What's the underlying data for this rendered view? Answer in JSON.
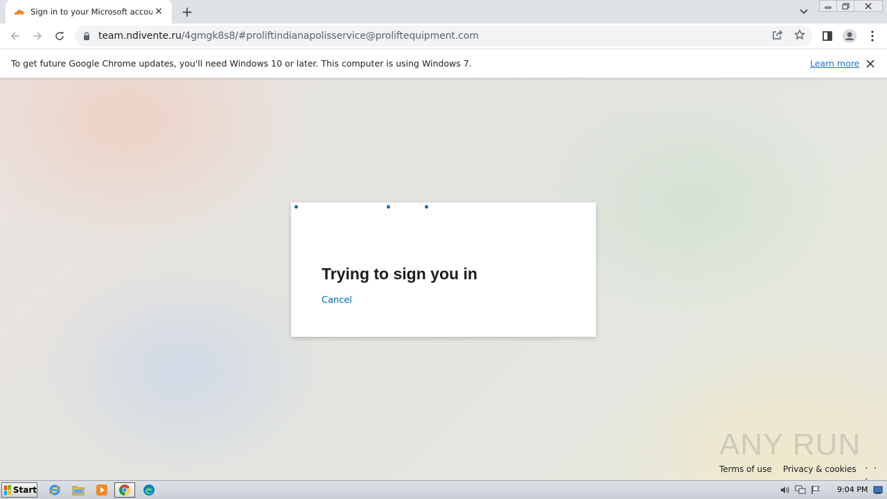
{
  "browser": {
    "tab": {
      "title": "Sign in to your Microsoft account",
      "favicon": "cloudflare-icon",
      "close_glyph": "✕"
    },
    "new_tab_glyph": "+",
    "address": {
      "host": "team.ndivente.ru",
      "path": "/4gmgk8s8/#proliftindianapolisservice@proliftequipment.com"
    }
  },
  "infobar": {
    "message": "To get future Google Chrome updates, you'll need Windows 10 or later. This computer is using Windows 7.",
    "link_label": "Learn more",
    "close_glyph": "✕"
  },
  "signin": {
    "title": "Trying to sign you in",
    "cancel_label": "Cancel",
    "accent_color": "#0067b8"
  },
  "footer": {
    "terms_label": "Terms of use",
    "privacy_label": "Privacy & cookies",
    "more_label": ". . ."
  },
  "watermark": {
    "text": "ANY RUN"
  },
  "taskbar": {
    "start_label": "Start",
    "clock": "9:04 PM",
    "apps": [
      "ie-icon",
      "explorer-icon",
      "media-player-icon",
      "chrome-icon",
      "edge-icon"
    ]
  }
}
